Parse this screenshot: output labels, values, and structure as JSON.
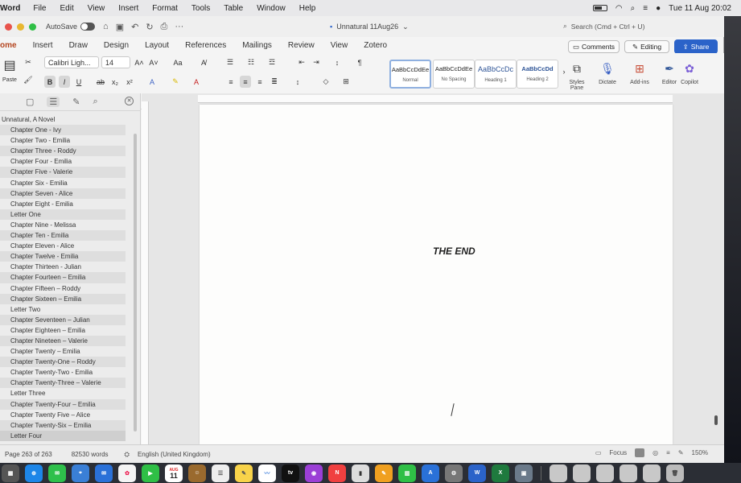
{
  "menubar": {
    "app": "Word",
    "items": [
      "File",
      "Edit",
      "View",
      "Insert",
      "Format",
      "Tools",
      "Table",
      "Window",
      "Help"
    ],
    "clock": "Tue 11 Aug  20:02"
  },
  "titlebar": {
    "autosave_label": "AutoSave",
    "doc_title": "Unnatural 11Aug26",
    "search_placeholder": "Search (Cmd + Ctrl + U)"
  },
  "tabs": [
    "ome",
    "Insert",
    "Draw",
    "Design",
    "Layout",
    "References",
    "Mailings",
    "Review",
    "View",
    "Zotero"
  ],
  "buttons": {
    "comments": "Comments",
    "editing": "Editing",
    "share": "Share"
  },
  "ribbon": {
    "paste_label": "Paste",
    "font_name": "Calibri Ligh...",
    "font_size": "14",
    "styles": [
      {
        "sample": "AaBbCcDdEe",
        "name": "Normal"
      },
      {
        "sample": "AaBbCcDdEe",
        "name": "No Spacing"
      },
      {
        "sample": "AaBbCcDc",
        "name": "Heading 1"
      },
      {
        "sample": "AaBbCcDd",
        "name": "Heading 2"
      }
    ],
    "styles_pane_label": "Styles Pane",
    "dictate_label": "Dictate",
    "addins_label": "Add-ins",
    "editor_label": "Editor",
    "copilot_label": "Copilot"
  },
  "outline": {
    "title": "Unnatural, A Novel",
    "items": [
      "Chapter One - Ivy",
      "Chapter Two - Emilia",
      "Chapter Three - Roddy",
      "Chapter Four - Emilia",
      "Chapter Five - Valerie",
      "Chapter Six - Emilia",
      "Chapter Seven - Alice",
      "Chapter Eight - Emilia",
      "Letter One",
      "Chapter Nine - Melissa",
      "Chapter Ten - Emilia",
      "Chapter Eleven - Alice",
      "Chapter Twelve - Emilia",
      "Chapter Thirteen - Julian",
      "Chapter Fourteen – Emilia",
      "Chapter Fifteen – Roddy",
      "Chapter Sixteen – Emilia",
      "Letter Two",
      "Chapter Seventeen – Julian",
      "Chapter Eighteen – Emilia",
      "Chapter Nineteen – Valerie",
      "Chapter Twenty – Emilia",
      "Chapter Twenty-One – Roddy",
      "Chapter Twenty-Two - Emilia",
      "Chapter Twenty-Three – Valerie",
      "Letter Three",
      "Chapter Twenty-Four – Emilia",
      "Chapter Twenty Five – Alice",
      "Chapter Twenty-Six – Emilia",
      "Letter Four"
    ]
  },
  "document": {
    "body_text": "THE END"
  },
  "statusbar": {
    "page": "Page 263 of 263",
    "words": "82530 words",
    "language": "English (United Kingdom)",
    "focus": "Focus",
    "zoom": "150%"
  },
  "dock": {
    "calendar_month": "AUG",
    "calendar_day": "11",
    "tv_label": "tv"
  },
  "colors": {
    "accent": "#b4451f",
    "share": "#2b63c9"
  }
}
